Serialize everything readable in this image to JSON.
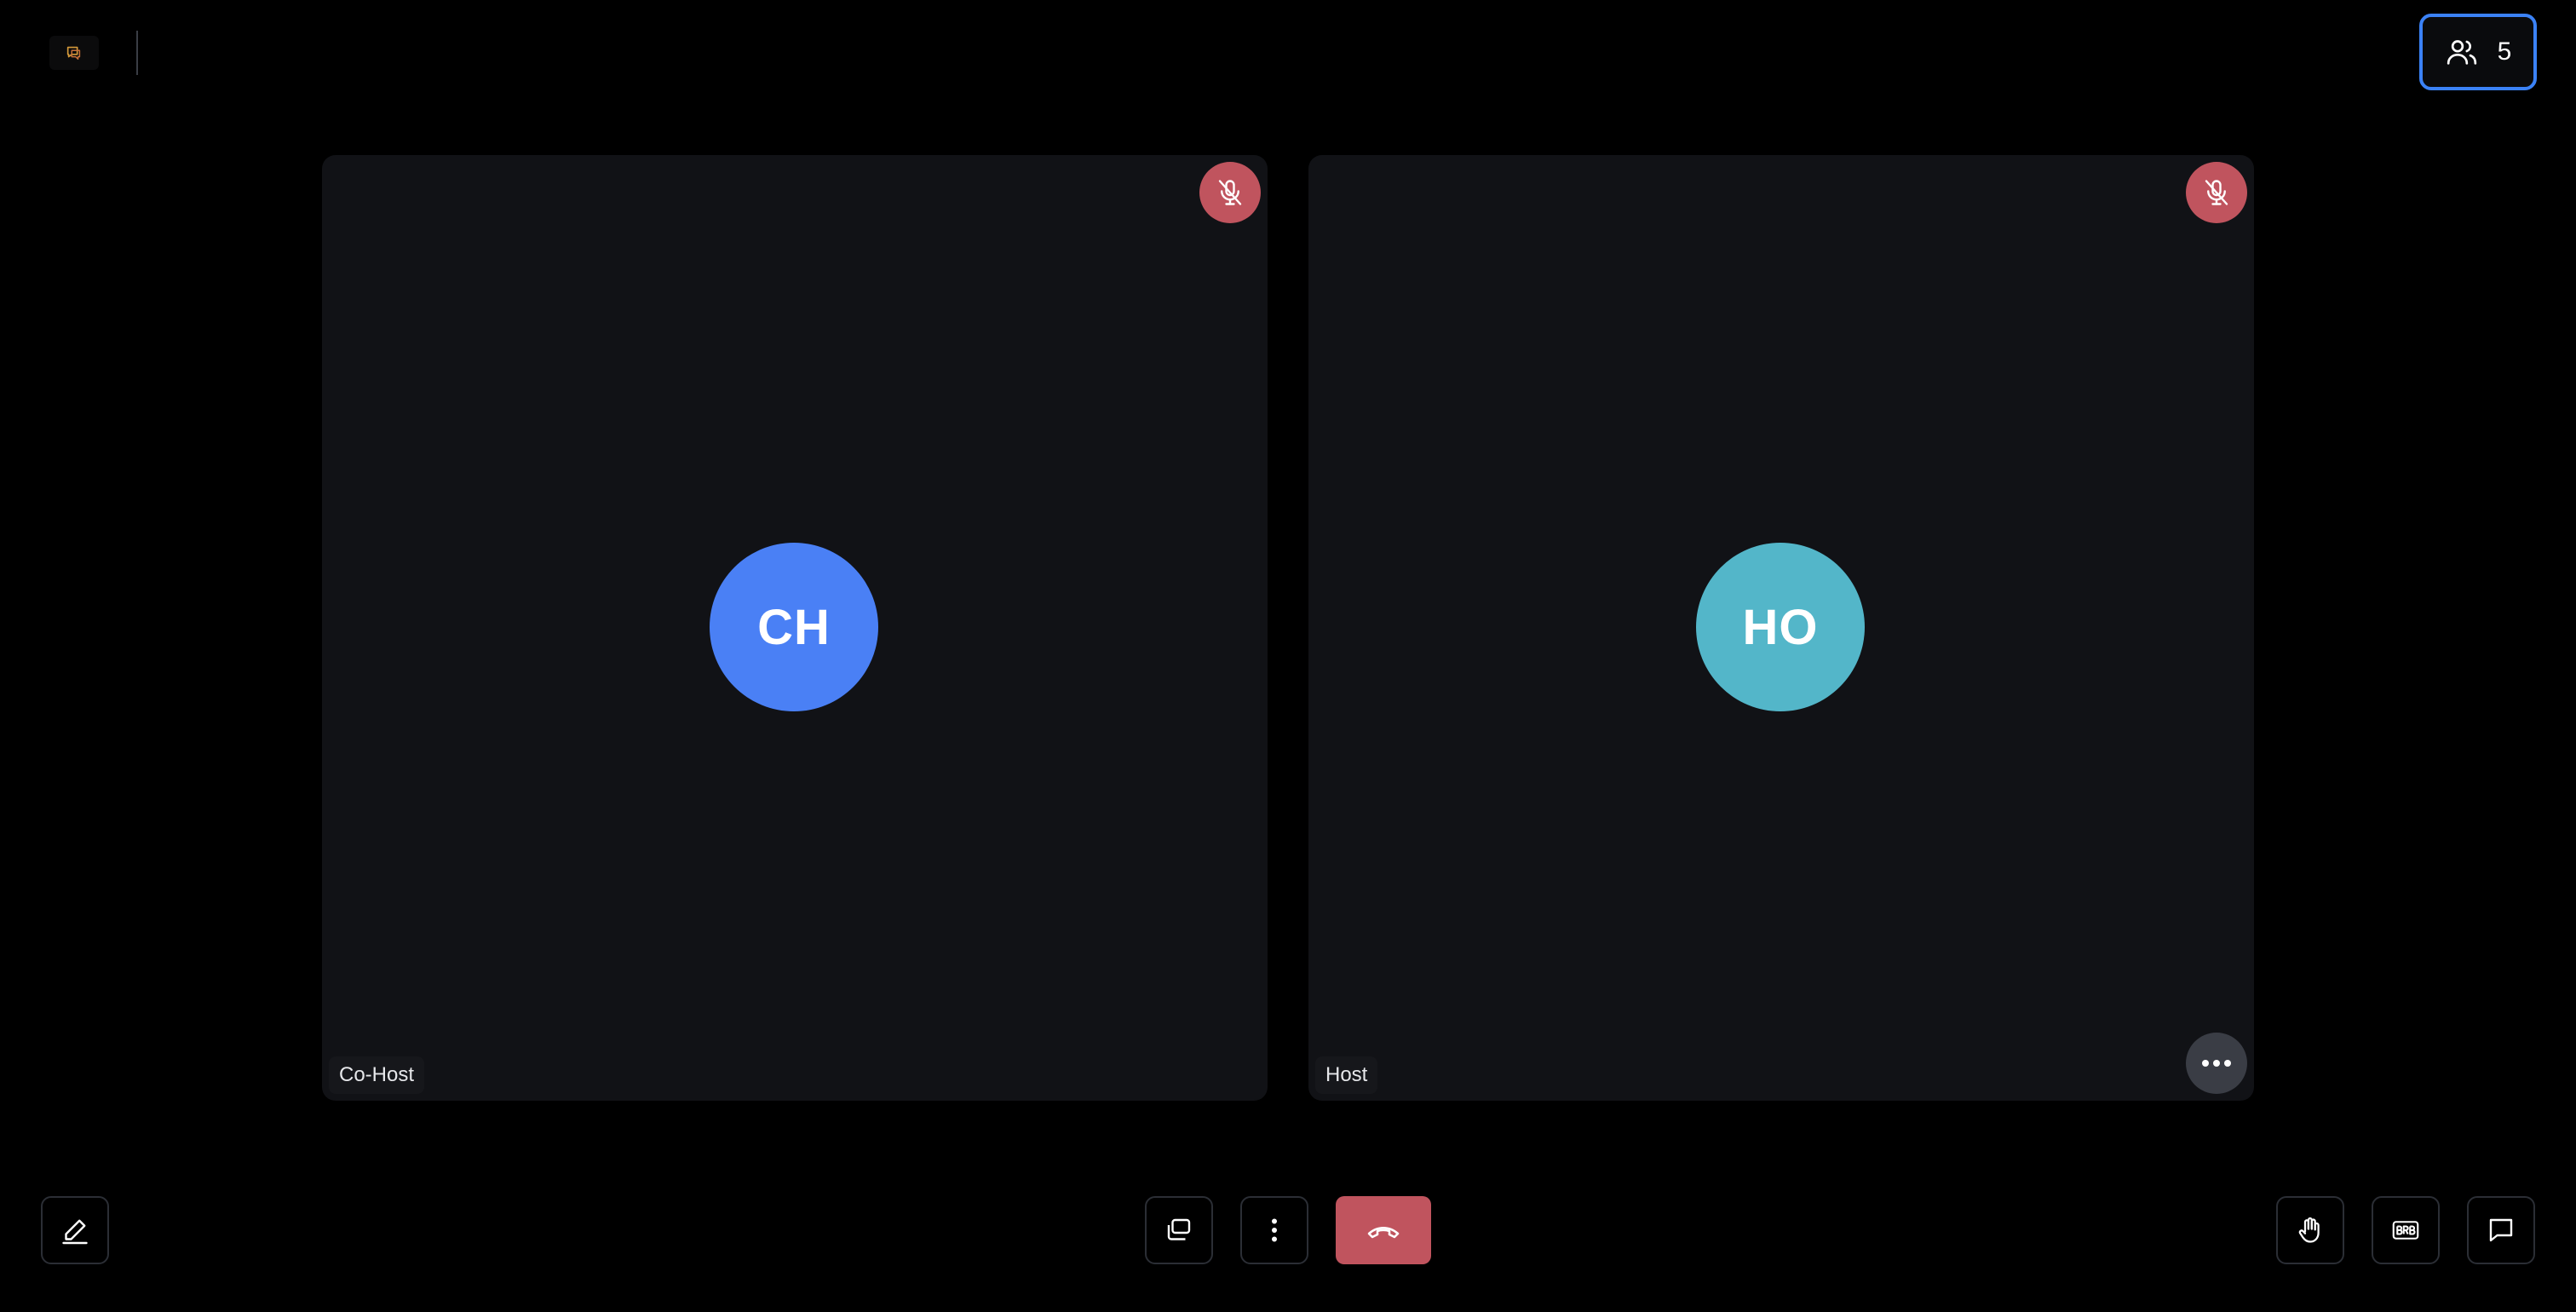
{
  "header": {
    "participants_count": "5",
    "accent_color": "#3b82f6"
  },
  "tiles": [
    {
      "initials": "CH",
      "name": "Co-Host",
      "avatar_color": "#4a80f5",
      "muted": true
    },
    {
      "initials": "HO",
      "name": "Host",
      "avatar_color": "#53b6c9",
      "muted": true
    }
  ],
  "toolbar": {
    "left": [
      "annotate-icon"
    ],
    "center": [
      "layout-icon",
      "more-vertical-icon",
      "end-call-icon"
    ],
    "right": [
      "raise-hand-icon",
      "brb-icon",
      "chat-icon"
    ],
    "end_call_color": "#c0545e"
  }
}
